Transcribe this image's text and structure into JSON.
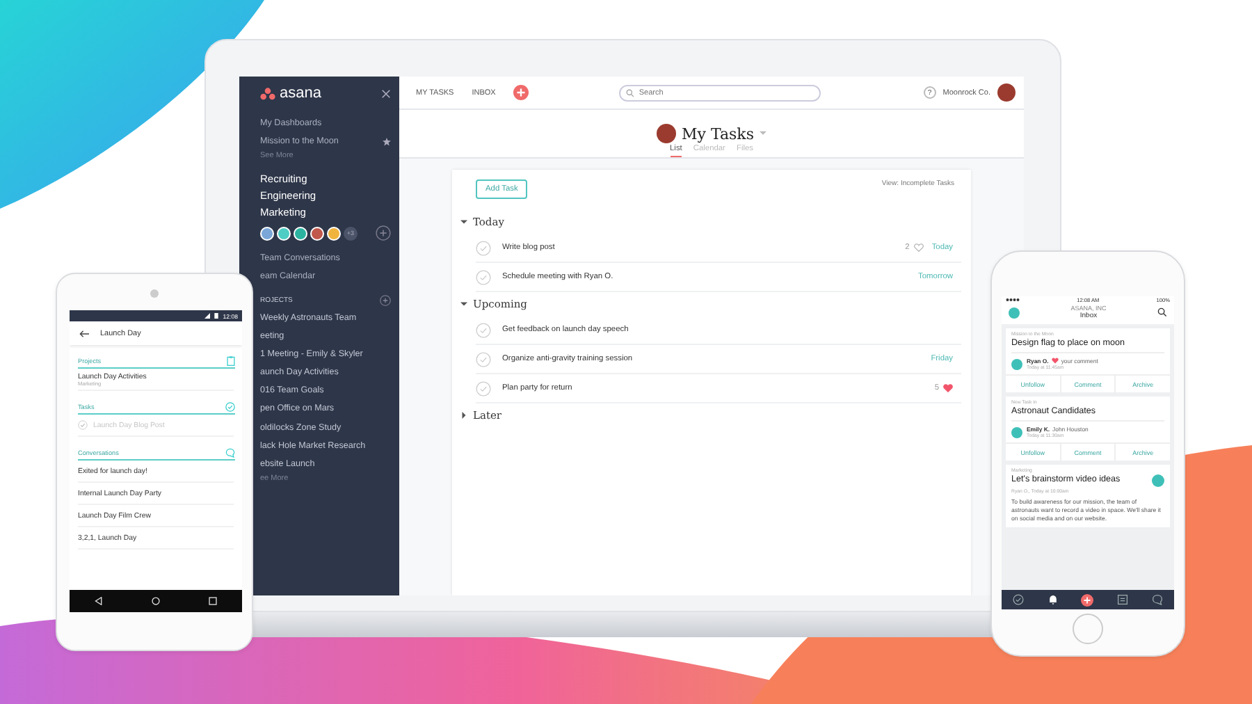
{
  "laptop": {
    "sidebar": {
      "logo": "asana",
      "favorites": [
        {
          "label": "My Dashboards",
          "starred": false
        },
        {
          "label": "Mission to the Moon",
          "starred": true
        }
      ],
      "favorites_more": "See More",
      "teams": [
        "Recruiting",
        "Engineering",
        "Marketing"
      ],
      "members_more": "+3",
      "team_links": [
        "Team Conversations",
        "eam Calendar"
      ],
      "projects_heading": "ROJECTS",
      "projects": [
        "Weekly Astronauts Team",
        "eeting",
        "1 Meeting - Emily & Skyler",
        "aunch Day Activities",
        "016 Team Goals",
        "pen Office on Mars",
        "oldilocks Zone Study",
        "lack Hole Market Research",
        "ebsite Launch"
      ],
      "projects_more": "ee More"
    },
    "topbar": {
      "nav": [
        "MY TASKS",
        "INBOX"
      ],
      "search": {
        "placeholder": "Search"
      },
      "help": "?",
      "workspace": "Moonrock Co."
    },
    "header": {
      "title": "My Tasks",
      "tabs": [
        {
          "label": "List",
          "selected": true
        },
        {
          "label": "Calendar",
          "selected": false
        },
        {
          "label": "Files",
          "selected": false
        }
      ]
    },
    "add_task": "Add Task",
    "view_filter": "View: Incomplete Tasks",
    "sections": [
      {
        "title": "Today",
        "expanded": true,
        "tasks": [
          {
            "name": "Write blog post",
            "likes": "2",
            "liked": false,
            "due": "Today"
          },
          {
            "name": "Schedule meeting with Ryan O.",
            "due": "Tomorrow"
          }
        ]
      },
      {
        "title": "Upcoming",
        "expanded": true,
        "tasks": [
          {
            "name": "Get feedback on launch day speech"
          },
          {
            "name": "Organize anti-gravity training session",
            "due": "Friday"
          },
          {
            "name": "Plan party for return",
            "likes": "5",
            "liked": true
          }
        ]
      },
      {
        "title": "Later",
        "expanded": false
      }
    ]
  },
  "android": {
    "time": "12:08",
    "query": "Launch Day",
    "groups": [
      {
        "kind": "projects",
        "title": "Projects",
        "items": [
          {
            "name": "Launch Day Activities",
            "sub": "Marketing"
          }
        ]
      },
      {
        "kind": "tasks",
        "title": "Tasks",
        "items": [
          {
            "name": "Launch Day Blog Post",
            "completed": true
          }
        ]
      },
      {
        "kind": "conversations",
        "title": "Conversations",
        "items": [
          {
            "name": "Exited for launch day!"
          },
          {
            "name": "Internal Launch Day Party"
          },
          {
            "name": "Launch Day Film Crew"
          },
          {
            "name": "3,2,1, Launch Day"
          }
        ]
      }
    ]
  },
  "iphone": {
    "time": "12:08 AM",
    "battery": "100%",
    "org": "ASANA, INC",
    "title": "Inbox",
    "cards": [
      {
        "kind": "activity",
        "context": "Mission to the Moon",
        "title": "Design flag to place on moon",
        "author": "Ryan O.",
        "hearted": true,
        "action": "your comment",
        "time": "Today at 11:45am",
        "actions": [
          "Unfollow",
          "Comment",
          "Archive"
        ]
      },
      {
        "kind": "activity",
        "context": "New Task in",
        "title": "Astronaut Candidates",
        "author": "Emily K.",
        "hearted": false,
        "action": "John Houston",
        "time": "Today at 11:30am",
        "actions": [
          "Unfollow",
          "Comment",
          "Archive"
        ]
      },
      {
        "kind": "post",
        "context": "Marketing",
        "title": "Let's brainstorm video ideas",
        "time": "Ryan O., Today at 10:00am",
        "body": "To build awareness for our mission, the team of astronauts want to record a video in space. We'll share it on social media and on our website."
      }
    ],
    "tab_bar": [
      {
        "kind": "tasks",
        "selected": false
      },
      {
        "kind": "inbox",
        "selected": true
      },
      {
        "kind": "add",
        "selected": false
      },
      {
        "kind": "projects",
        "selected": false
      },
      {
        "kind": "conversations",
        "selected": false
      }
    ]
  }
}
